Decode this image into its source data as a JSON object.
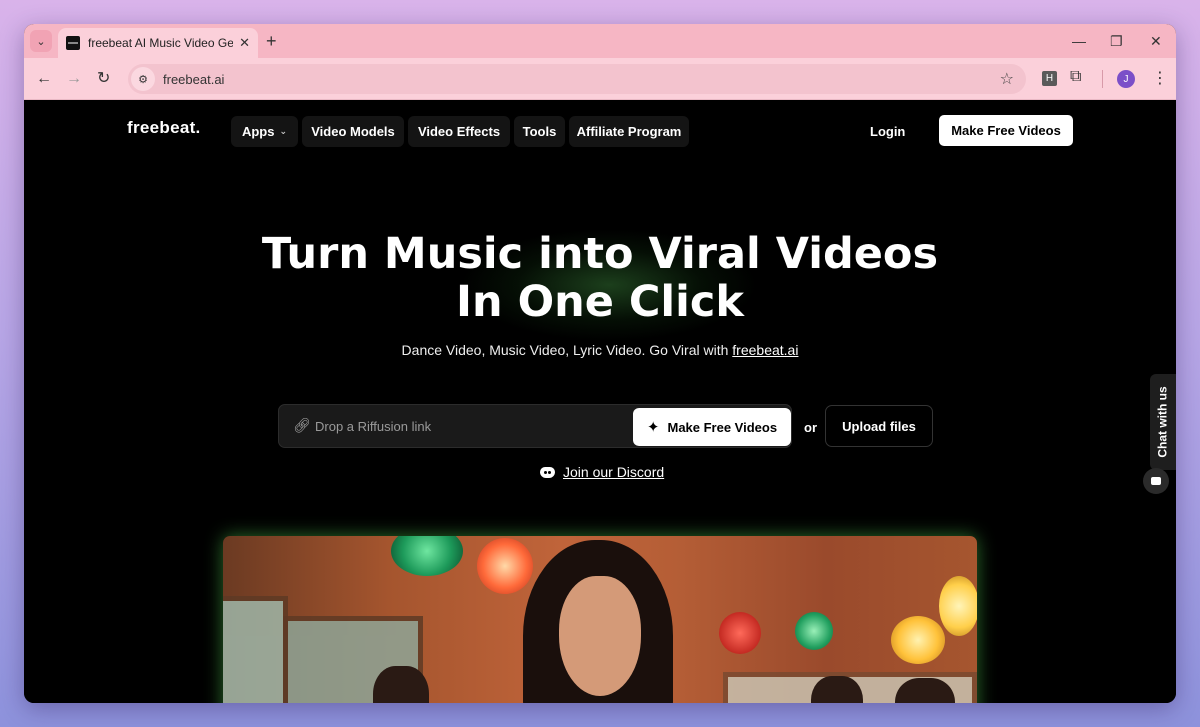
{
  "browser": {
    "tab_title": "freebeat AI Music Video Genera",
    "tab_close": "✕",
    "new_tab": "+",
    "url": "freebeat.ai",
    "extension_label": "H",
    "profile_initial": "J",
    "window_controls": {
      "minimize": "—",
      "restore": "❐",
      "close": "✕"
    },
    "nav": {
      "back": "←",
      "forward": "→",
      "reload": "↻"
    }
  },
  "site": {
    "logo": "freebeat.",
    "nav_items": [
      {
        "label": "Apps",
        "has_dropdown": true
      },
      {
        "label": "Video Models"
      },
      {
        "label": "Video Effects"
      },
      {
        "label": "Tools"
      },
      {
        "label": "Affiliate Program"
      }
    ],
    "login_label": "Login",
    "cta_label": "Make Free Videos"
  },
  "hero": {
    "title_line1": "Turn Music into Viral Videos",
    "title_line2": "In One Click",
    "subtitle": "Dance Video, Music Video, Lyric Video. Go Viral with ",
    "subtitle_link": "freebeat.ai",
    "input_placeholder": "Drop a Riffusion link",
    "make_button": "Make Free Videos",
    "or_text": "or",
    "upload_button": "Upload files",
    "discord_label": "Join our Discord"
  },
  "chat": {
    "label": "Chat with us"
  },
  "icons": {
    "menu": "chevron-down-icon",
    "link": "link-icon",
    "sparkle": "sparkle-icon",
    "discord": "discord-icon",
    "chat": "chat-icon"
  },
  "colors": {
    "page_bg": "#000000",
    "browser_chrome": "#fbd0da",
    "accent_glow": "#50b450"
  }
}
